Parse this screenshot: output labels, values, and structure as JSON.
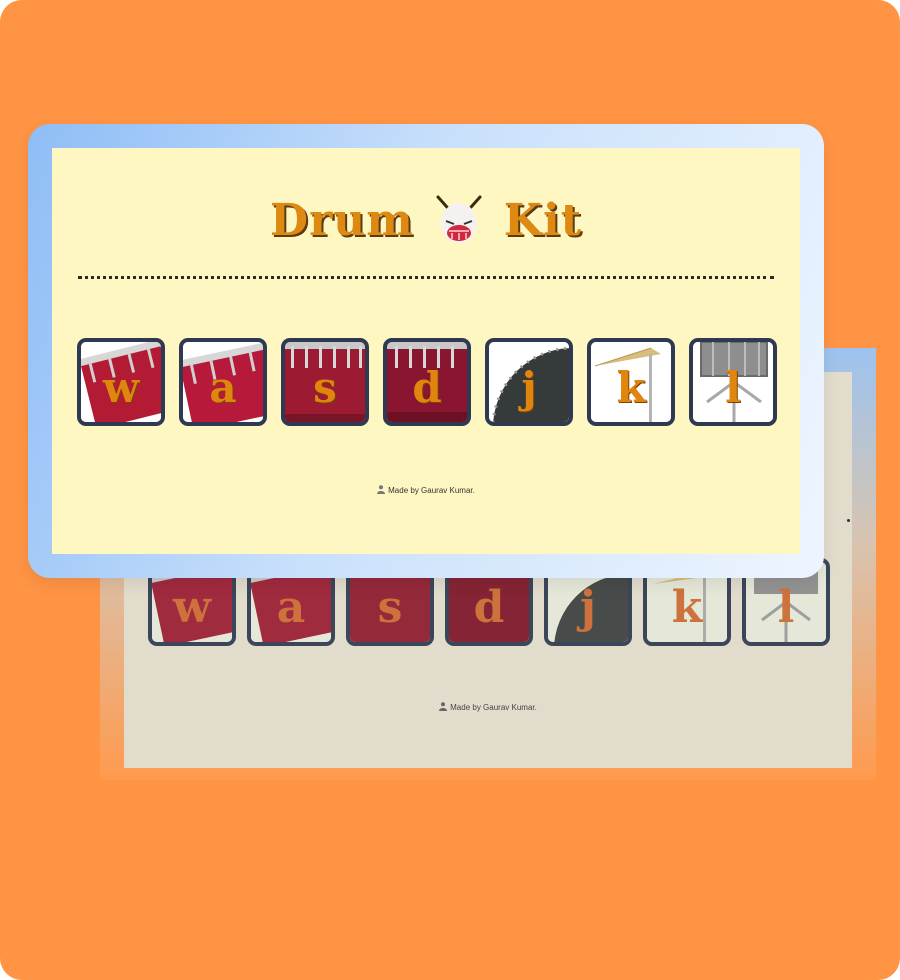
{
  "app": {
    "title_left": "Drum",
    "title_right": "Kit",
    "title_icon": "drum-face-icon",
    "credit": "Made by Gaurav Kumar.",
    "credit_icon": "person-icon"
  },
  "pads": [
    {
      "key": "w",
      "instrument": "tom-1"
    },
    {
      "key": "a",
      "instrument": "tom-2"
    },
    {
      "key": "s",
      "instrument": "tom-3"
    },
    {
      "key": "d",
      "instrument": "tom-4"
    },
    {
      "key": "j",
      "instrument": "snare"
    },
    {
      "key": "k",
      "instrument": "crash"
    },
    {
      "key": "l",
      "instrument": "kick-bass"
    }
  ],
  "colors": {
    "background": "#ff9444",
    "page": "#fff7c2",
    "title": "#de8a12",
    "pad_border": "#2f3a52",
    "drum_red": "#b31b34"
  }
}
